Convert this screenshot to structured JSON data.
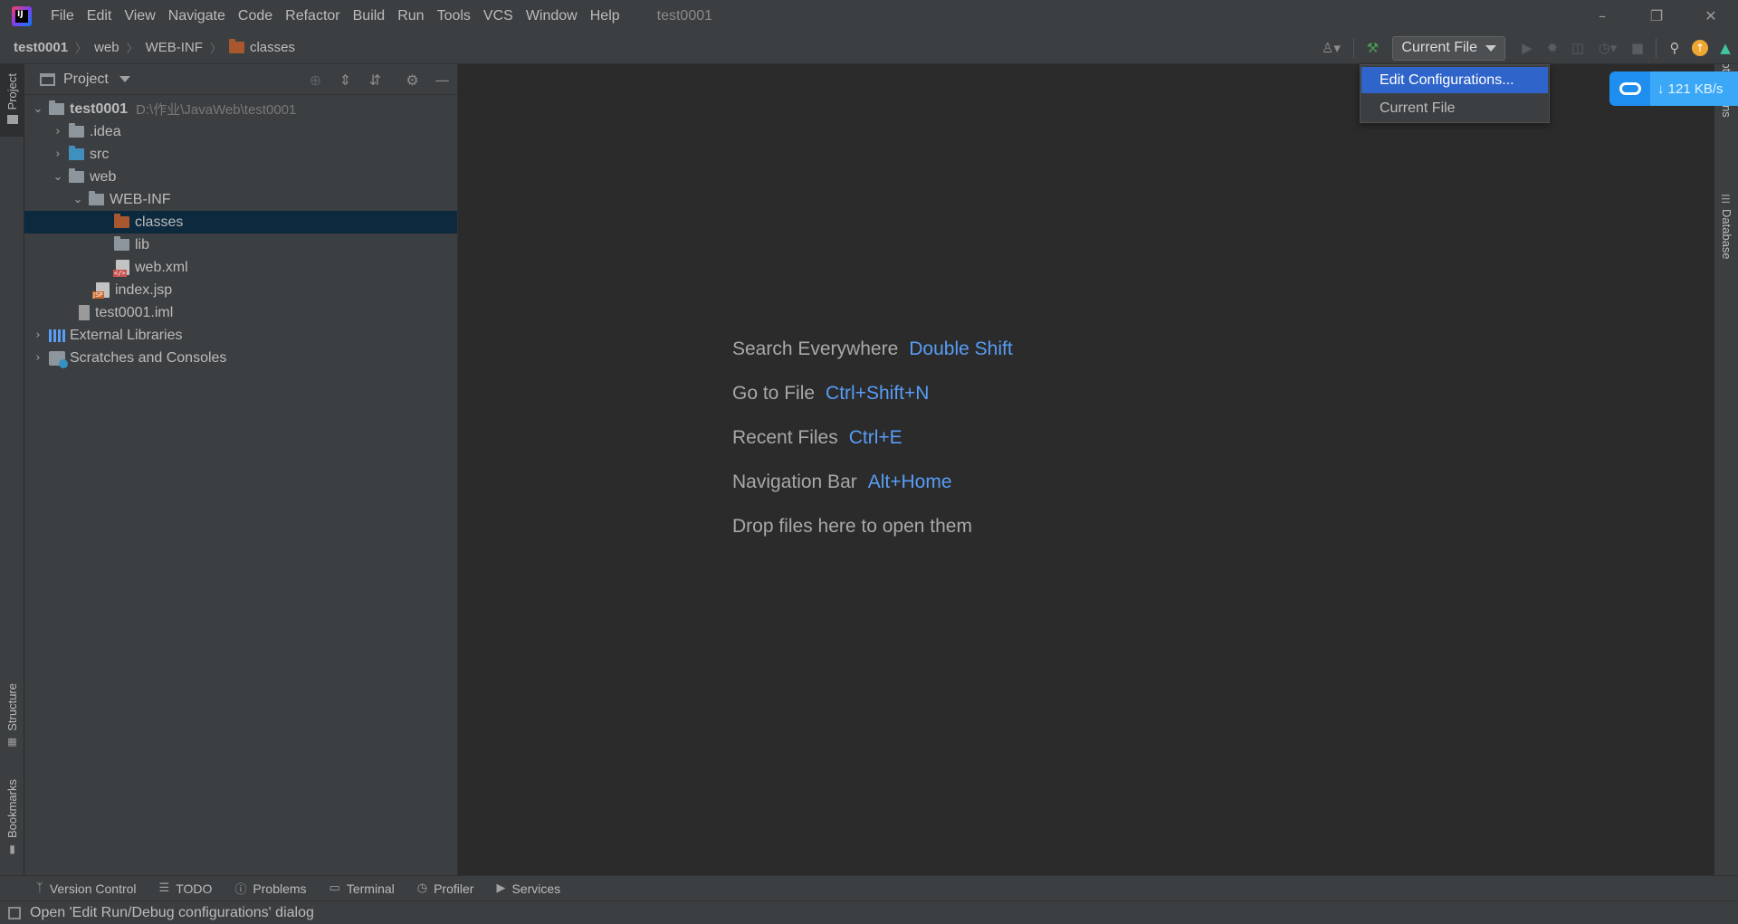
{
  "titlebar": {
    "logo_text": "IJ",
    "menu": [
      "File",
      "Edit",
      "View",
      "Navigate",
      "Code",
      "Refactor",
      "Build",
      "Run",
      "Tools",
      "VCS",
      "Window",
      "Help"
    ],
    "window_title": "test0001",
    "controls": {
      "minimize": "–",
      "restore": "❐",
      "close": "✕"
    }
  },
  "navbar": {
    "breadcrumbs": [
      "test0001",
      "web",
      "WEB-INF",
      "classes"
    ],
    "separator": "〉",
    "run_config": "Current File"
  },
  "left_stripe": {
    "top_tab": "Project",
    "structure_tab": "Structure",
    "bookmarks_tab": "Bookmarks"
  },
  "right_stripe": {
    "notifications_tab": "Notifications",
    "database_tab": "Database"
  },
  "project_panel": {
    "title": "Project",
    "tree": [
      {
        "label": "test0001",
        "hint": "D:\\作业\\JavaWeb\\test0001"
      },
      {
        "label": ".idea"
      },
      {
        "label": "src"
      },
      {
        "label": "web"
      },
      {
        "label": "WEB-INF"
      },
      {
        "label": "classes"
      },
      {
        "label": "lib"
      },
      {
        "label": "web.xml"
      },
      {
        "label": "index.jsp"
      },
      {
        "label": "test0001.iml"
      },
      {
        "label": "External Libraries"
      },
      {
        "label": "Scratches and Consoles"
      }
    ]
  },
  "editor": {
    "hints": [
      {
        "label": "Search Everywhere",
        "key": "Double Shift"
      },
      {
        "label": "Go to File",
        "key": "Ctrl+Shift+N"
      },
      {
        "label": "Recent Files",
        "key": "Ctrl+E"
      },
      {
        "label": "Navigation Bar",
        "key": "Alt+Home"
      },
      {
        "label": "Drop files here to open them",
        "key": ""
      }
    ]
  },
  "popup": {
    "items": [
      "Edit Configurations...",
      "Current File"
    ]
  },
  "download_widget": {
    "speed": "↓ 121 KB/s"
  },
  "bottom_bar": {
    "tabs": [
      "Version Control",
      "TODO",
      "Problems",
      "Terminal",
      "Profiler",
      "Services"
    ]
  },
  "status_bar": {
    "message": "Open 'Edit Run/Debug configurations' dialog"
  },
  "colors": {
    "background": "#2b2b2b",
    "panel": "#3c3f41",
    "selection": "#0d293e",
    "accent_blue": "#589df6",
    "popup_selected": "#2f65ca",
    "folder_orange": "#a9572f"
  }
}
